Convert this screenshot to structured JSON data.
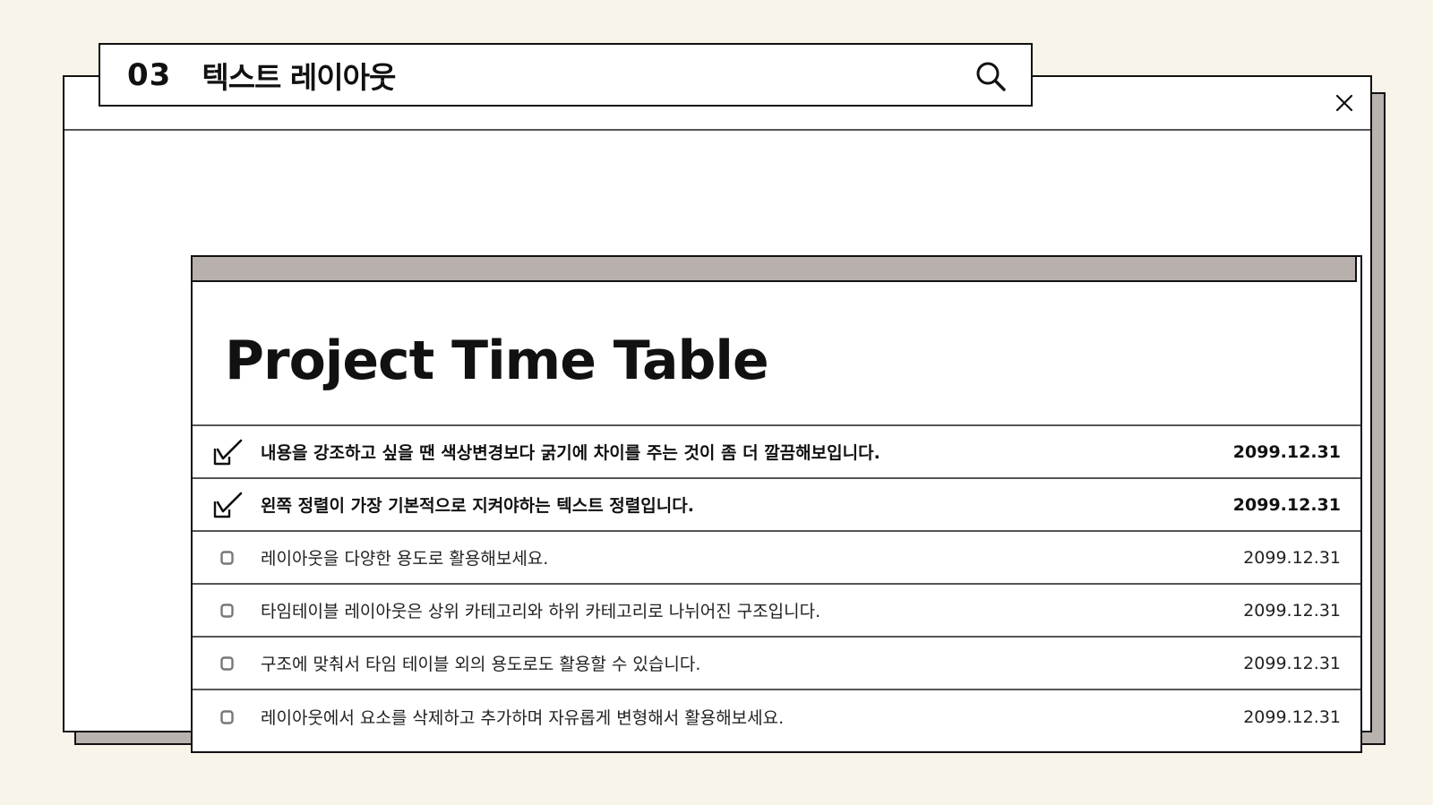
{
  "header": {
    "section_number": "03",
    "section_title": "텍스트 레이아웃"
  },
  "card": {
    "title": "Project Time Table"
  },
  "rows": [
    {
      "checked": true,
      "text": "내용을 강조하고 싶을 땐 색상변경보다 굵기에 차이를 주는 것이 좀 더 깔끔해보입니다.",
      "date": "2099.12.31"
    },
    {
      "checked": true,
      "text": "왼쪽 정렬이 가장 기본적으로 지켜야하는 텍스트 정렬입니다.",
      "date": "2099.12.31"
    },
    {
      "checked": false,
      "text": "레이아웃을 다양한 용도로 활용해보세요.",
      "date": "2099.12.31"
    },
    {
      "checked": false,
      "text": "타임테이블 레이아웃은 상위 카테고리와 하위 카테고리로 나뉘어진 구조입니다.",
      "date": "2099.12.31"
    },
    {
      "checked": false,
      "text": "구조에 맞춰서 타임 테이블 외의 용도로도 활용할 수 있습니다.",
      "date": "2099.12.31"
    },
    {
      "checked": false,
      "text": "레이아웃에서 요소를 삭제하고 추가하며 자유롭게 변형해서 활용해보세요.",
      "date": "2099.12.31"
    }
  ],
  "icons": {
    "search": "search-icon",
    "close": "close-icon",
    "checked": "checkmark-box-icon",
    "unchecked": "empty-checkbox-icon"
  },
  "colors": {
    "background": "#f8f4ea",
    "shadow": "#b9b3b0",
    "header_bar": "#b7b0ad"
  }
}
